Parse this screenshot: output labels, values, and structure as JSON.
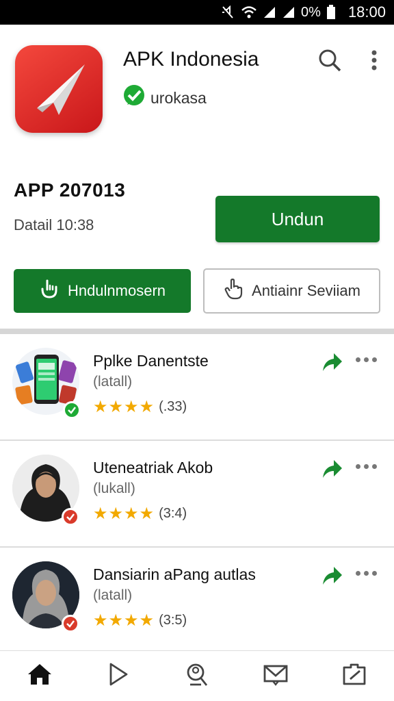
{
  "status_bar": {
    "battery_percent": "0%",
    "time": "18:00",
    "icons": [
      "mute-icon",
      "wifi-icon",
      "signal-icon",
      "signal-icon",
      "battery-icon"
    ]
  },
  "app": {
    "title": "APK Indonesia",
    "developer": "urokasa",
    "app_id": "APP 207013",
    "detail": "Datail 10:38",
    "primary_button": "Undun",
    "secondary_button": "Hndulnmosern",
    "outline_button": "Antiainr Seviiam",
    "icon_color": "#e5292a"
  },
  "colors": {
    "accent_green": "#14792a",
    "star": "#f2a900"
  },
  "list": [
    {
      "title": "Pplke Danentste",
      "subtitle": "(latall)",
      "stars": "★★★★",
      "count": "(.33)",
      "badge": "green-check"
    },
    {
      "title": "Uteneatriak Akob",
      "subtitle": "(lukall)",
      "stars": "★★★★",
      "count": "(3:4)",
      "badge": "red-check"
    },
    {
      "title": "Dansiarin aPang autlas",
      "subtitle": "(latall)",
      "stars": "★★★★",
      "count": "(3:5)",
      "badge": "red-check"
    }
  ],
  "bottom_nav": [
    "home-icon",
    "play-icon",
    "search-profile-icon",
    "mail-icon",
    "edit-icon"
  ]
}
